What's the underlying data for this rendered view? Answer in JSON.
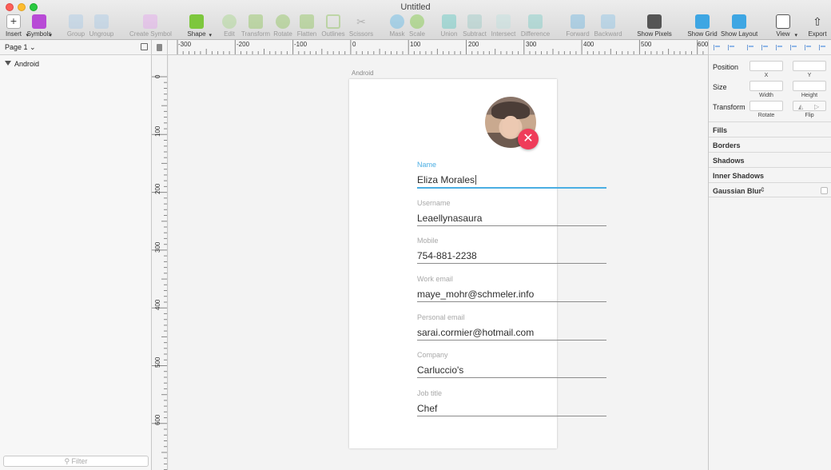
{
  "window": {
    "title": "Untitled"
  },
  "toolbar": {
    "insert": "Insert",
    "symbols": "Symbols",
    "group": "Group",
    "ungroup": "Ungroup",
    "create_symbol": "Create Symbol",
    "shape": "Shape",
    "edit": "Edit",
    "transform": "Transform",
    "rotate": "Rotate",
    "flatten": "Flatten",
    "outlines": "Outlines",
    "scissors": "Scissors",
    "mask": "Mask",
    "scale": "Scale",
    "union": "Union",
    "subtract": "Subtract",
    "intersect": "Intersect",
    "difference": "Difference",
    "forward": "Forward",
    "backward": "Backward",
    "show_pixels": "Show Pixels",
    "show_grid": "Show Grid",
    "show_layout": "Show Layout",
    "view": "View",
    "export": "Export"
  },
  "pages": {
    "selected": "Page 1"
  },
  "layers": {
    "items": [
      {
        "name": "Android"
      }
    ],
    "filter_placeholder": "Filter"
  },
  "rulers": {
    "horizontal": [
      "-300",
      "-200",
      "-100",
      "0",
      "100",
      "200",
      "300",
      "400",
      "500",
      "600"
    ],
    "vertical": [
      "0",
      "100",
      "200",
      "300",
      "400",
      "500",
      "600"
    ]
  },
  "artboard": {
    "name": "Android",
    "fields": [
      {
        "label": "Name",
        "value": "Eliza Morales",
        "active": true
      },
      {
        "label": "Username",
        "value": "Leaellynasaura"
      },
      {
        "label": "Mobile",
        "value": "754-881-2238"
      },
      {
        "label": "Work email",
        "value": "maye_mohr@schmeler.info"
      },
      {
        "label": "Personal email",
        "value": "sarai.cormier@hotmail.com"
      },
      {
        "label": "Company",
        "value": "Carluccio's"
      },
      {
        "label": "Job title",
        "value": "Chef"
      }
    ],
    "remove_symbol": "✕"
  },
  "inspector": {
    "position": "Position",
    "x": "X",
    "y": "Y",
    "size": "Size",
    "width": "Width",
    "height": "Height",
    "transform": "Transform",
    "rotate": "Rotate",
    "flip": "Flip",
    "sections": [
      "Fills",
      "Borders",
      "Shadows",
      "Inner Shadows",
      "Gaussian Blur"
    ]
  },
  "colors": {
    "accent": "#4aaee3",
    "remove_button": "#ef3c5a"
  }
}
